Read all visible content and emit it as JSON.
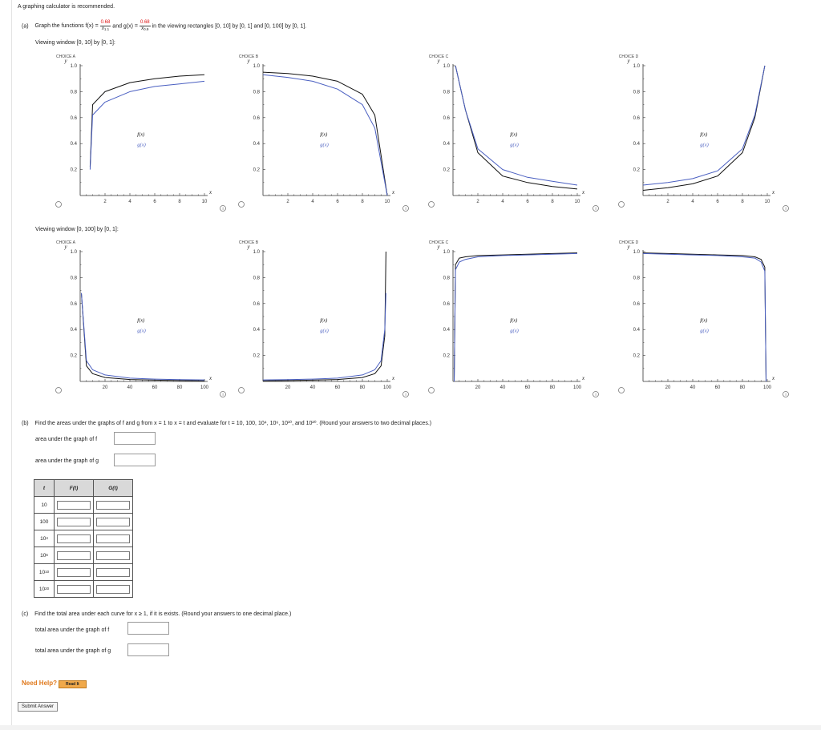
{
  "header": {
    "note": "A graphing calculator is recommended.",
    "part_a_label": "(a)",
    "part_a_text_1": "Graph the functions f(x) =",
    "f_num": "0.68",
    "f_den": "x",
    "f_exp": "1.1",
    "part_a_and": "and g(x) =",
    "g_num": "0.68",
    "g_den": "x",
    "g_exp": "0.9",
    "part_a_text_2": "in the viewing rectangles [0, 10] by [0, 1] and [0, 100] by [0, 1]."
  },
  "windows": [
    {
      "label": "Viewing window [0, 10] by [0, 1]:",
      "xmax": 10,
      "x_ticks": [
        "2",
        "4",
        "6",
        "8",
        "10"
      ]
    },
    {
      "label": "Viewing window [0, 100] by [0, 1]:",
      "xmax": 100,
      "x_ticks": [
        "20",
        "40",
        "60",
        "80",
        "100"
      ]
    }
  ],
  "choices": [
    "CHOICE A",
    "CHOICE B",
    "CHOICE C",
    "CHOICE D"
  ],
  "chart_labels": {
    "y": "y",
    "x": "x",
    "f": "f(x)",
    "g": "g(x)",
    "y_ticks": [
      "1.0",
      "0.8",
      "0.6",
      "0.4",
      "0.2"
    ]
  },
  "chart_data": [
    {
      "type": "line",
      "window": "[0, 10] by [0, 1]",
      "choice": "CHOICE A",
      "xlim": [
        0,
        10
      ],
      "ylim": [
        0,
        1
      ],
      "series": [
        {
          "name": "f(x)",
          "x": [
            0.8,
            1,
            2,
            4,
            6,
            8,
            10
          ],
          "y": [
            0.22,
            0.7,
            0.8,
            0.87,
            0.9,
            0.92,
            0.93
          ]
        },
        {
          "name": "g(x)",
          "x": [
            0.8,
            1,
            2,
            4,
            6,
            8,
            10
          ],
          "y": [
            0.2,
            0.62,
            0.72,
            0.8,
            0.84,
            0.86,
            0.88
          ]
        }
      ]
    },
    {
      "type": "line",
      "window": "[0, 10] by [0, 1]",
      "choice": "CHOICE B",
      "xlim": [
        0,
        10
      ],
      "ylim": [
        0,
        1
      ],
      "series": [
        {
          "name": "f(x)",
          "x": [
            0,
            2,
            4,
            6,
            8,
            9,
            10
          ],
          "y": [
            0.95,
            0.94,
            0.92,
            0.88,
            0.78,
            0.62,
            0.0
          ]
        },
        {
          "name": "g(x)",
          "x": [
            0,
            2,
            4,
            6,
            8,
            9,
            10
          ],
          "y": [
            0.93,
            0.91,
            0.88,
            0.82,
            0.7,
            0.52,
            0.0
          ]
        }
      ]
    },
    {
      "type": "line",
      "window": "[0, 10] by [0, 1]",
      "choice": "CHOICE C",
      "xlim": [
        0,
        10
      ],
      "ylim": [
        0,
        1
      ],
      "series": [
        {
          "name": "f(x)",
          "x": [
            0.2,
            1,
            2,
            4,
            6,
            8,
            10
          ],
          "y": [
            1.0,
            0.66,
            0.33,
            0.15,
            0.1,
            0.07,
            0.05
          ]
        },
        {
          "name": "g(x)",
          "x": [
            0.2,
            1,
            2,
            4,
            6,
            8,
            10
          ],
          "y": [
            1.0,
            0.66,
            0.36,
            0.2,
            0.14,
            0.11,
            0.08
          ]
        }
      ]
    },
    {
      "type": "line",
      "window": "[0, 10] by [0, 1]",
      "choice": "CHOICE D",
      "xlim": [
        0,
        10
      ],
      "ylim": [
        0,
        1
      ],
      "series": [
        {
          "name": "f(x)",
          "x": [
            0,
            2,
            4,
            6,
            8,
            9,
            9.5,
            9.8
          ],
          "y": [
            0.04,
            0.06,
            0.09,
            0.15,
            0.33,
            0.6,
            0.85,
            1.0
          ]
        },
        {
          "name": "g(x)",
          "x": [
            0,
            2,
            4,
            6,
            8,
            9,
            9.5,
            9.8
          ],
          "y": [
            0.08,
            0.1,
            0.13,
            0.19,
            0.36,
            0.62,
            0.86,
            1.0
          ]
        }
      ]
    },
    {
      "type": "line",
      "window": "[0, 100] by [0, 1]",
      "choice": "CHOICE A",
      "xlim": [
        0,
        100
      ],
      "ylim": [
        0,
        1
      ],
      "series": [
        {
          "name": "f(x)",
          "x": [
            1,
            5,
            10,
            20,
            40,
            60,
            80,
            100
          ],
          "y": [
            0.68,
            0.12,
            0.06,
            0.03,
            0.015,
            0.01,
            0.007,
            0.005
          ]
        },
        {
          "name": "g(x)",
          "x": [
            1,
            5,
            10,
            20,
            40,
            60,
            80,
            100
          ],
          "y": [
            0.68,
            0.16,
            0.09,
            0.05,
            0.025,
            0.018,
            0.014,
            0.012
          ]
        }
      ]
    },
    {
      "type": "line",
      "window": "[0, 100] by [0, 1]",
      "choice": "CHOICE B",
      "xlim": [
        0,
        100
      ],
      "ylim": [
        0,
        1
      ],
      "series": [
        {
          "name": "f(x)",
          "x": [
            0,
            20,
            40,
            60,
            80,
            90,
            95,
            98,
            99
          ],
          "y": [
            0.005,
            0.007,
            0.01,
            0.015,
            0.03,
            0.06,
            0.12,
            0.35,
            1.0
          ]
        },
        {
          "name": "g(x)",
          "x": [
            0,
            20,
            40,
            60,
            80,
            90,
            95,
            98,
            99
          ],
          "y": [
            0.012,
            0.014,
            0.018,
            0.025,
            0.05,
            0.09,
            0.16,
            0.4,
            0.68
          ]
        }
      ]
    },
    {
      "type": "line",
      "window": "[0, 100] by [0, 1]",
      "choice": "CHOICE C",
      "xlim": [
        0,
        100
      ],
      "ylim": [
        0,
        1
      ],
      "series": [
        {
          "name": "f(x)",
          "x": [
            1,
            2,
            5,
            10,
            20,
            40,
            60,
            80,
            100
          ],
          "y": [
            0.0,
            0.9,
            0.95,
            0.96,
            0.97,
            0.975,
            0.98,
            0.985,
            0.99
          ]
        },
        {
          "name": "g(x)",
          "x": [
            1,
            2,
            5,
            10,
            20,
            40,
            60,
            80,
            100
          ],
          "y": [
            0.0,
            0.86,
            0.92,
            0.94,
            0.96,
            0.97,
            0.975,
            0.98,
            0.985
          ]
        }
      ]
    },
    {
      "type": "line",
      "window": "[0, 100] by [0, 1]",
      "choice": "CHOICE D",
      "xlim": [
        0,
        100
      ],
      "ylim": [
        0,
        1
      ],
      "series": [
        {
          "name": "f(x)",
          "x": [
            0,
            20,
            40,
            60,
            80,
            90,
            95,
            98,
            99
          ],
          "y": [
            0.99,
            0.985,
            0.98,
            0.975,
            0.97,
            0.96,
            0.94,
            0.88,
            0.0
          ]
        },
        {
          "name": "g(x)",
          "x": [
            0,
            20,
            40,
            60,
            80,
            90,
            95,
            98,
            99
          ],
          "y": [
            0.985,
            0.98,
            0.975,
            0.97,
            0.96,
            0.95,
            0.92,
            0.85,
            0.0
          ]
        }
      ]
    }
  ],
  "part_b": {
    "label": "(b)",
    "text": "Find the areas under the graphs of f and g from x = 1 to x = t and evaluate for t = 10, 100, 10⁴, 10⁶, 10¹⁰, and 10²⁰. (Round your answers to two decimal places.)",
    "area_f_label": "area under the graph of f",
    "area_g_label": "area under the graph of g",
    "table_headers": [
      "t",
      "F(t)",
      "G(t)"
    ],
    "t_rows": [
      {
        "base": "10",
        "exp": ""
      },
      {
        "base": "100",
        "exp": ""
      },
      {
        "base": "10",
        "exp": "4"
      },
      {
        "base": "10",
        "exp": "6"
      },
      {
        "base": "10",
        "exp": "10"
      },
      {
        "base": "10",
        "exp": "20"
      }
    ]
  },
  "part_c": {
    "label": "(c)",
    "text": "Find the total area under each curve for x ≥ 1, if it is exists. (Round your answers to one decimal place.)",
    "total_f_label": "total area under the graph of f",
    "total_g_label": "total area under the graph of g"
  },
  "help": {
    "label": "Need Help?",
    "button": "Read It"
  },
  "submit": {
    "label": "Submit Answer"
  },
  "colors": {
    "f_curve": "#111111",
    "g_curve": "#4a5fc1",
    "axis": "#333333",
    "accent_red": "#dd1111",
    "help_orange": "#e07a1e"
  }
}
